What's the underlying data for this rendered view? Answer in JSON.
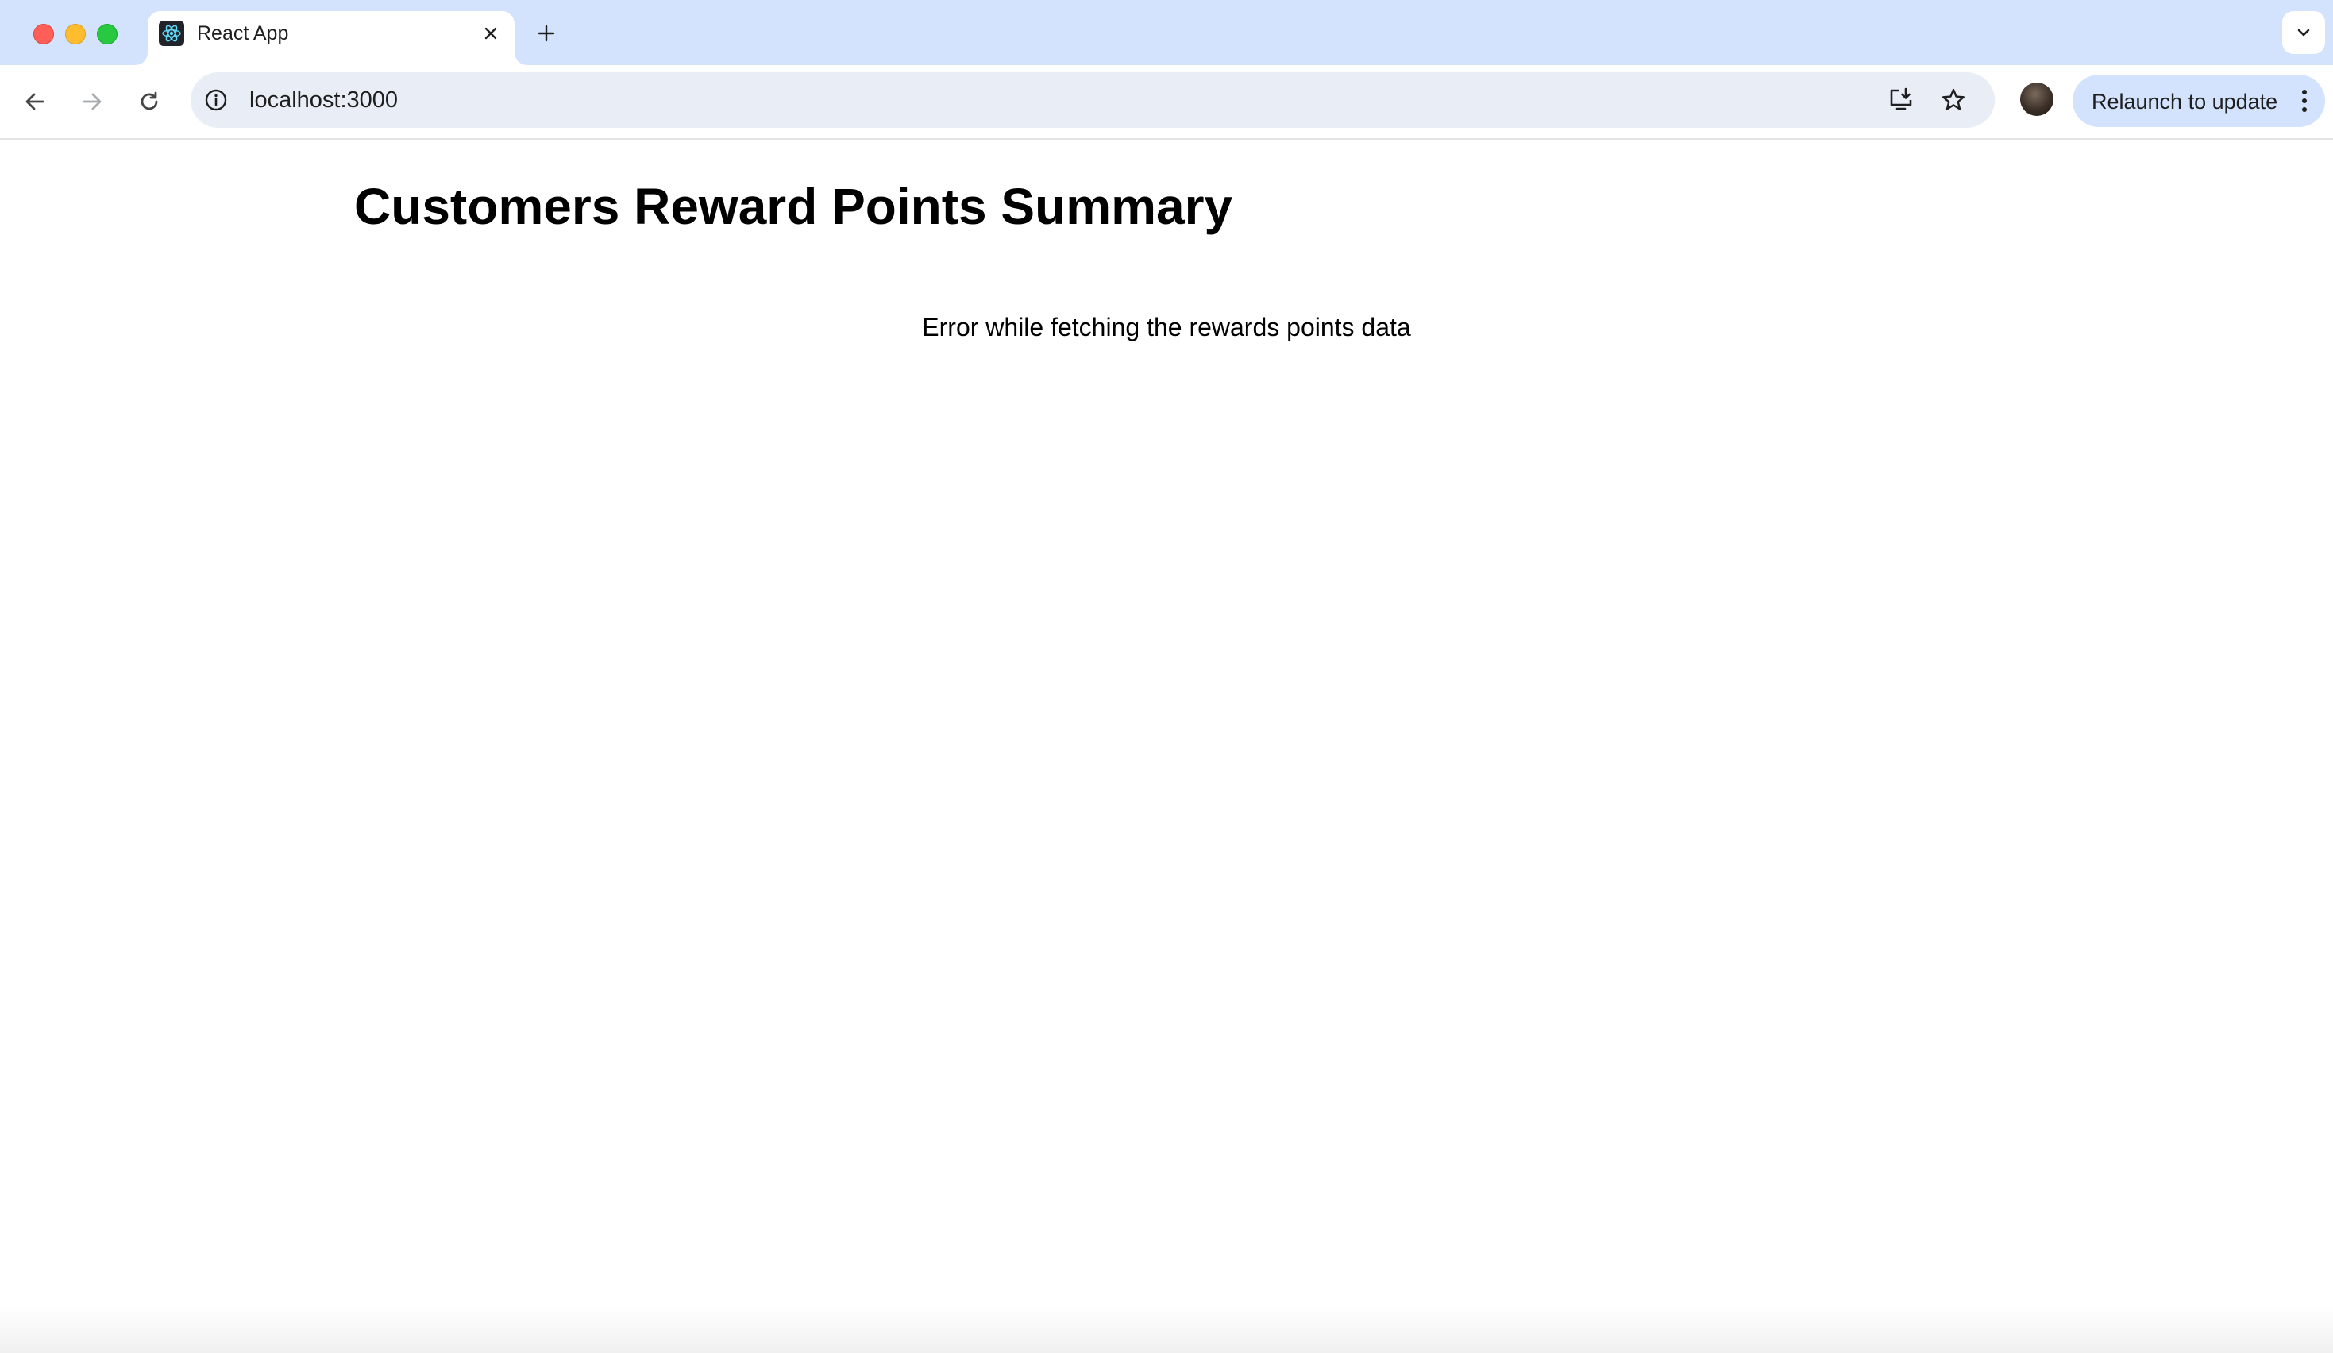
{
  "browser": {
    "tab": {
      "title": "React App",
      "favicon": "react-logo-icon"
    },
    "address_bar": {
      "url": "localhost:3000"
    },
    "relaunch_label": "Relaunch to update",
    "icons": {
      "back": "back-arrow-icon",
      "forward": "forward-arrow-icon",
      "reload": "reload-icon",
      "info": "info-icon",
      "install": "install-app-icon",
      "bookmark": "star-icon",
      "menu": "kebab-menu-icon",
      "new_tab": "plus-icon",
      "tab_search": "chevron-down-icon",
      "close_tab": "close-icon"
    },
    "colors": {
      "tabstrip": "#d3e3fd",
      "omnibox": "#e9eef6",
      "relaunch": "#d3e3fd",
      "close_dot": "#ff5f57",
      "minimize_dot": "#febc2e",
      "maximize_dot": "#28c840"
    }
  },
  "page": {
    "title": "Customers Reward Points Summary",
    "error_message": "Error while fetching the rewards points data"
  }
}
